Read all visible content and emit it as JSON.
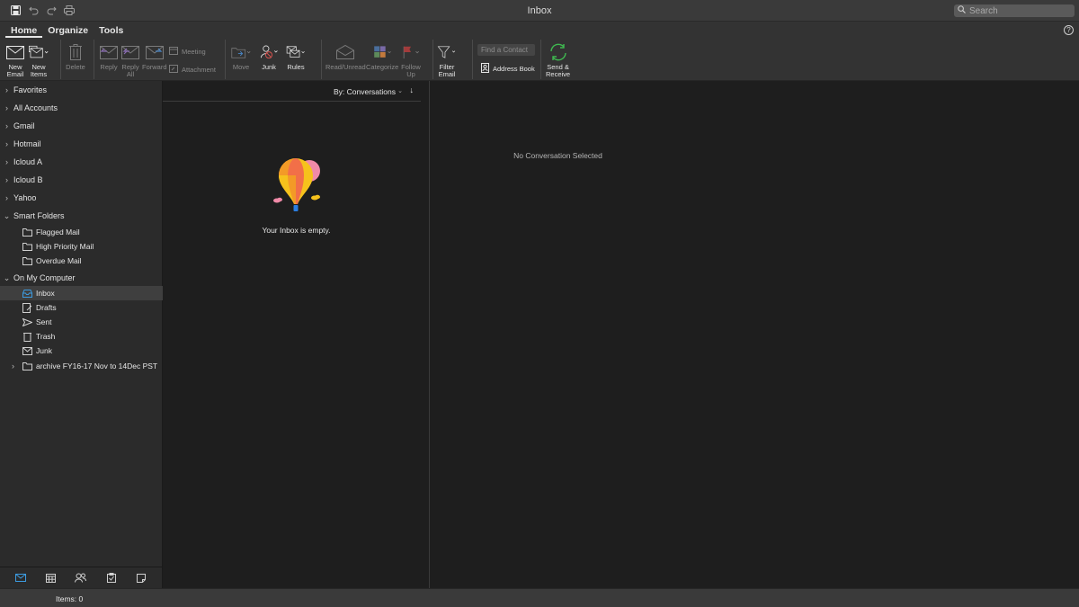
{
  "window": {
    "title": "Inbox"
  },
  "search": {
    "placeholder": "Search"
  },
  "ribbon": {
    "tabs": [
      {
        "label": "Home"
      },
      {
        "label": "Organize"
      },
      {
        "label": "Tools"
      }
    ],
    "buttons": {
      "new_email": {
        "l1": "New",
        "l2": "Email"
      },
      "new_items": {
        "l1": "New",
        "l2": "Items"
      },
      "delete": {
        "l1": "Delete"
      },
      "reply": {
        "l1": "Reply"
      },
      "reply_all": {
        "l1": "Reply",
        "l2": "All"
      },
      "forward": {
        "l1": "Forward"
      },
      "meeting": "Meeting",
      "attachment": "Attachment",
      "move": {
        "l1": "Move"
      },
      "junk": {
        "l1": "Junk"
      },
      "rules": {
        "l1": "Rules"
      },
      "read_unread": {
        "l1": "Read/Unread"
      },
      "categorize": {
        "l1": "Categorize"
      },
      "follow_up": {
        "l1": "Follow",
        "l2": "Up"
      },
      "filter_email": {
        "l1": "Filter",
        "l2": "Email"
      },
      "find_contact_placeholder": "Find a Contact",
      "address_book": "Address Book",
      "send_receive": {
        "l1": "Send &",
        "l2": "Receive"
      }
    }
  },
  "sidebar": {
    "accounts": [
      {
        "label": "Favorites"
      },
      {
        "label": "All Accounts"
      },
      {
        "label": "Gmail"
      },
      {
        "label": "Hotmail"
      },
      {
        "label": "Icloud A"
      },
      {
        "label": "Icloud B"
      },
      {
        "label": "Yahoo"
      }
    ],
    "smart_folders": {
      "label": "Smart Folders",
      "items": [
        {
          "label": "Flagged Mail"
        },
        {
          "label": "High Priority Mail"
        },
        {
          "label": "Overdue Mail"
        }
      ]
    },
    "on_my_computer": {
      "label": "On My Computer",
      "items": [
        {
          "label": "Inbox",
          "icon": "inbox-icon"
        },
        {
          "label": "Drafts",
          "icon": "drafts-icon"
        },
        {
          "label": "Sent",
          "icon": "sent-icon"
        },
        {
          "label": "Trash",
          "icon": "trash-icon"
        },
        {
          "label": "Junk",
          "icon": "junk-icon"
        },
        {
          "label": "archive FY16-17 Nov to 14Dec PST",
          "icon": "folder-icon"
        }
      ]
    }
  },
  "message_list": {
    "sort_label": "By: Conversations",
    "empty_text": "Your Inbox is empty."
  },
  "reading_pane": {
    "placeholder": "No Conversation Selected"
  },
  "status": {
    "items": "Items: 0"
  },
  "colors": {
    "accent": "#1e90d6",
    "background": "#1e1e1e",
    "sidebar": "#2b2b2b"
  }
}
